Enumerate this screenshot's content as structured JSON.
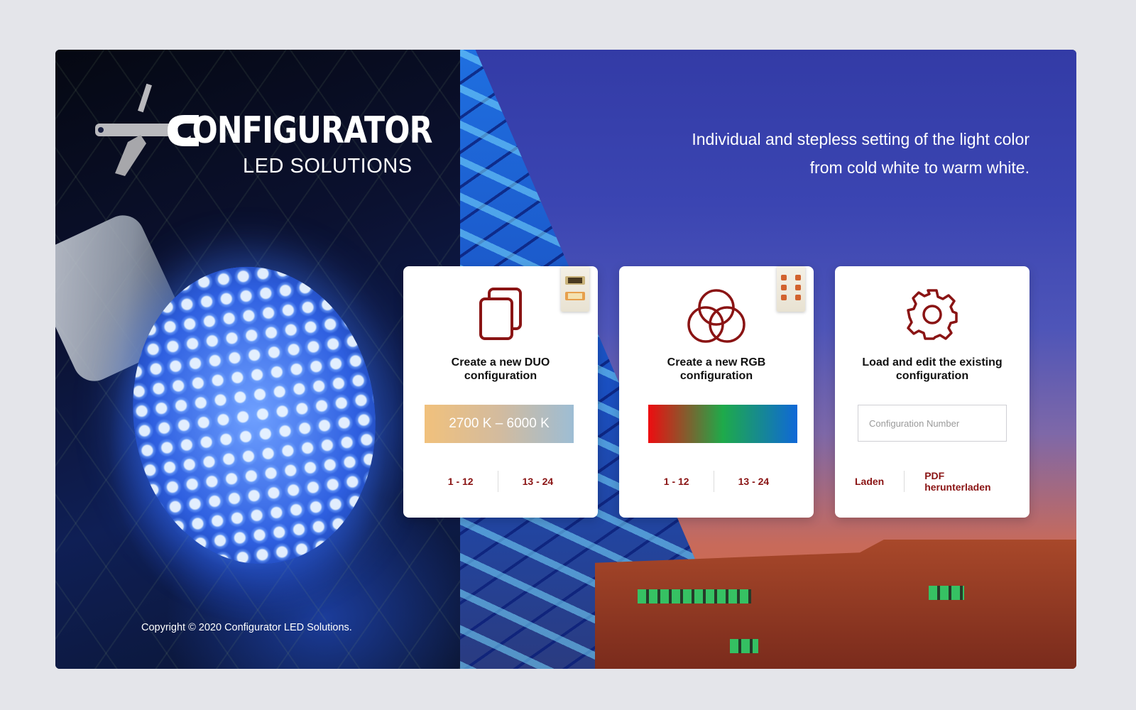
{
  "brand": {
    "title": "CONFIGURATOR",
    "subtitle": "LED SOLUTIONS"
  },
  "tagline": "Individual and stepless setting of the light color from cold white to warm white.",
  "copyright": "Copyright © 2020 Configurator LED Solutions.",
  "cards": [
    {
      "title": "Create a new DUO configuration",
      "swatch_label": "2700 K – 6000 K",
      "link_a": "1 - 12",
      "link_b": "13 - 24"
    },
    {
      "title": "Create a new RGB configuration",
      "swatch_label": "",
      "link_a": "1 - 12",
      "link_b": "13 - 24"
    },
    {
      "title": "Load and edit the existing configuration",
      "input_placeholder": "Configuration Number",
      "input_value": "",
      "link_a": "Laden",
      "link_b": "PDF herunterladen"
    }
  ],
  "colors": {
    "accent": "#8a1414",
    "page_bg": "#e4e5ea",
    "duo_warm": "#f1c17c",
    "duo_cold": "#9dbdd4",
    "rgb_red": "#ee0c10",
    "rgb_green": "#1eaa4a",
    "rgb_blue": "#0f68d8"
  },
  "icons": [
    "wrench-screwdriver-icon",
    "copy-icon",
    "rgb-circles-icon",
    "gear-icon",
    "led-strip-icon"
  ]
}
